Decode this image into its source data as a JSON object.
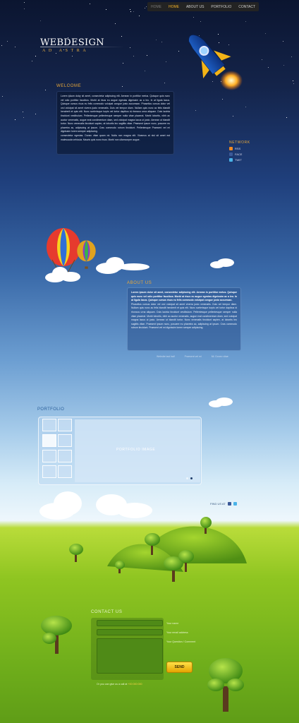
{
  "nav": {
    "items": [
      {
        "label": "HOME",
        "state": "dim"
      },
      {
        "label": "HOME",
        "state": "active"
      },
      {
        "label": "ABOUT US",
        "state": "normal"
      },
      {
        "label": "PORTFOLIO",
        "state": "normal"
      },
      {
        "label": "CONTACT",
        "state": "normal"
      }
    ]
  },
  "logo": {
    "title": "WEBDESIGN",
    "tagline": "AD ASTRA"
  },
  "welcome": {
    "heading": "WELCOME",
    "body": "Lorem ipsum dolor sit amet, consectetur adipiscing elit. Aenean in porttitor metus. Quisque quis nunc vel odio porttitor faucibus. Morbi at risus eu augue egestas dignissim ac a leo. In at ligula lacus. Quisque cursus risus eu felis commodo volutpat congue justo accumsan. Phasellus cursus dolor vel orci volutpat sit amet viverra justo venenatis. Duis vel tempor diam. Nullam quis nunc ac felis blandit hendrerit et quis elit. Nunc scelerisque turpis vel tortor dapibus id rhoncus urna aliquam. Duis lacinia tincidunt vestibulum. Pellentesque pellentesque semper nulla vitae placerat. Morbi lobortis, nibh ac auctor venenatis, augue erat condimentum diam, sed volutpat magna lacus ut justo. Aenean ut blandit tortor. Nunc venenatis tincidunt sapien, at lobortis leo sagittis vitae. Praesent ipsum nunc, posuere eu pharetra ac, adipiscing at ipsum. Cras commodo rutrum tincidunt. Pellentesque Praesent vel mi dignissim lorem semper adipiscing.",
    "body2": "consectetur egestas. Donec vitae quam mi. Nulla non magna elit. Vivamus at nisl sit amet est malesuada vehicula. Mauris quis nunc risus. Morbi non ullamcorper augue."
  },
  "network": {
    "heading": "NETWORK",
    "items": [
      {
        "label": "RSS",
        "color": "#f08a24"
      },
      {
        "label": "FACE",
        "color": "#3b5998"
      },
      {
        "label": "TWIT",
        "color": "#4ab3e8"
      }
    ]
  },
  "about": {
    "heading": "ABOUT US",
    "lead": "Lorem ipsum dolor sit amet, consectetur adipiscing elit. Aenean in porttitor metus. Quisque quis nunc vel odio porttitor faucibus. Morbi at risus eu augue egestas dignissim ac a leo. In at ligula lacus. Quisque cursus risus eu felis commodo volutpat congue justo accumsan.",
    "body": "Phasellus cursus dolor vel orci volutpat sit amet viverra justo venenatis. Duis vel tempor diam. Nullam quis nunc ac felis blandit hendrerit et quis elit. Nunc scelerisque turpis vel tortor dapibus id rhoncus urna aliquam. Duis lacinia tincidunt vestibulum. Pellentesque pellentesque semper nulla vitae placerat. Morbi lobortis, nibh ac auctor venenatis, augue erat condimentum diam, sed volutpat magna lacus ut justo. Aenean ut blandit tortor. Nunc venenatis tincidunt sapien, at lobortis leo sagittis vitae. Praesent ipsum nunc, posuere eu pharetra ac, adipiscing at ipsum. Cras commodo rutrum tincidunt. Praesent vel mi dignissim lorem semper adipiscing.",
    "meta": [
      "Website last half",
      "Praesent vel mi",
      "Mi. Donec vitae"
    ]
  },
  "portfolio": {
    "heading": "PORTFOLIO",
    "placeholder": "PORTFOLIO IMAGE"
  },
  "findus": {
    "label": "FIND US AT"
  },
  "contact": {
    "heading": "CONTACT US",
    "fields": [
      "Your name",
      "Your email address",
      "Your Question / Comment"
    ],
    "send": "SEND",
    "foot_prefix": "Or you can give us a call at",
    "phone": "+00 000 000"
  },
  "colors": {
    "accent": "#e9a93a",
    "send": "#f2c200",
    "grass": "#7fb81f"
  }
}
